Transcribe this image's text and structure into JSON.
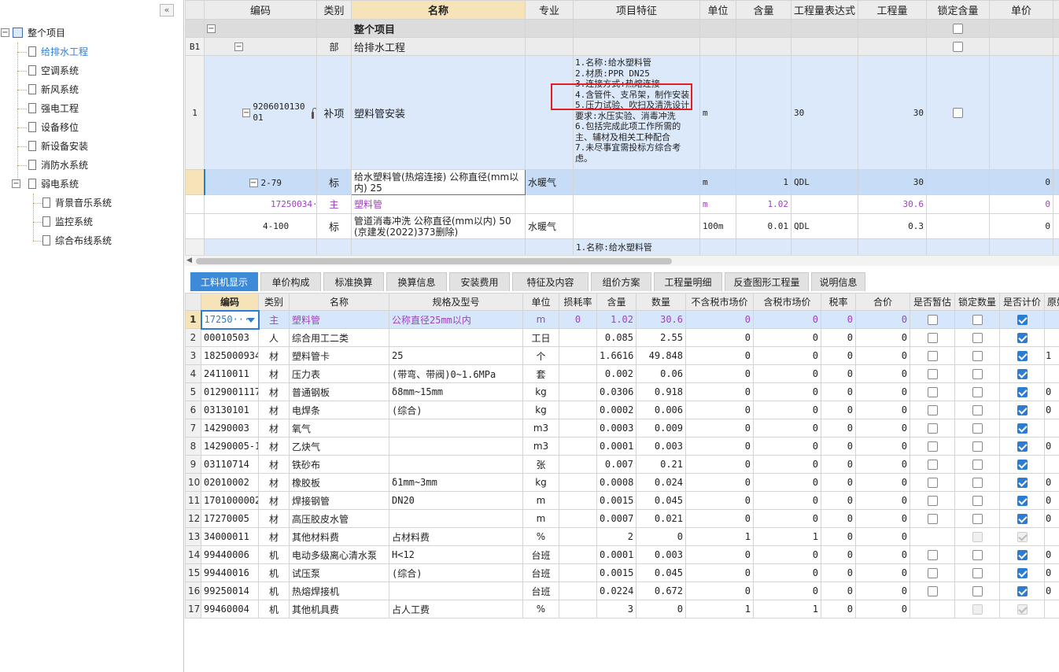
{
  "sidebar": {
    "collapse_label": "«",
    "root": "整个项目",
    "items": [
      {
        "label": "给排水工程",
        "selected": true
      },
      {
        "label": "空调系统"
      },
      {
        "label": "新风系统"
      },
      {
        "label": "强电工程"
      },
      {
        "label": "设备移位"
      },
      {
        "label": "新设备安装"
      },
      {
        "label": "消防水系统"
      }
    ],
    "group": {
      "label": "弱电系统",
      "children": [
        "背景音乐系统",
        "监控系统",
        "综合布线系统"
      ]
    }
  },
  "top_table": {
    "headers": [
      "",
      "编码",
      "类别",
      "名称",
      "专业",
      "项目特征",
      "单位",
      "含量",
      "工程量表达式",
      "工程量",
      "锁定含量",
      "单价"
    ],
    "rows": {
      "project": {
        "name": "整个项目"
      },
      "b1": {
        "index": "B1",
        "category": "部",
        "name": "给排水工程"
      },
      "r1": {
        "index": "1",
        "code_line1": "9206010130",
        "code_line2": "01",
        "lock_icon": "lock-icon",
        "category": "补项",
        "name": "塑料管安装",
        "features": [
          "1.名称:给水塑料管",
          "2.材质:PPR DN25",
          "3.连接方式:热熔连接",
          "4.含管件、支吊架，制作安装",
          "5.压力试验、吹扫及清洗设计要求:水压实验、消毒冲洗",
          "6.包括完成此项工作所需的主、辅材及相关工种配合",
          "7.未尽事宜需投标方综合考虑。"
        ],
        "unit": "m",
        "expr": "30",
        "qty": "30"
      },
      "r279": {
        "code": "2-79",
        "category": "标",
        "name": "给水塑料管(热熔连接) 公称直径(mm以内) 25",
        "major": "水暖气",
        "unit": "m",
        "content": "1",
        "expr": "QDL",
        "qty": "30",
        "price": "0"
      },
      "r1725": {
        "code": "17250034···",
        "category": "主",
        "name": "塑料管",
        "unit": "m",
        "content": "1.02",
        "qty": "30.6",
        "price": "0"
      },
      "r4100": {
        "code": "4-100",
        "category": "标",
        "name": "管道消毒冲洗 公称直径(mm以内) 50 (京建发(2022)373删除)",
        "major": "水暖气",
        "unit": "100m",
        "content": "0.01",
        "expr": "QDL",
        "qty": "0.3",
        "price": "0"
      },
      "partial": {
        "feature": "1.名称:给水塑料管"
      }
    }
  },
  "tabs": [
    "工料机显示",
    "单价构成",
    "标准换算",
    "换算信息",
    "安装费用",
    "特征及内容",
    "组价方案",
    "工程量明细",
    "反查图形工程量",
    "说明信息"
  ],
  "bottom_table": {
    "headers": [
      "",
      "编码",
      "类别",
      "名称",
      "规格及型号",
      "单位",
      "损耗率",
      "含量",
      "数量",
      "不含税市场价",
      "含税市场价",
      "税率",
      "合价",
      "是否暂估",
      "锁定数量",
      "是否计价",
      "原始"
    ],
    "rows": [
      [
        "1",
        "17250···",
        "主",
        "塑料管",
        "公称直径25mm以内",
        "m",
        "0",
        "1.02",
        "30.6",
        "0",
        "0",
        "0",
        "0"
      ],
      [
        "2",
        "00010503",
        "人",
        "综合用工二类",
        "",
        "工日",
        "",
        "0.085",
        "2.55",
        "0",
        "0",
        "0",
        "0"
      ],
      [
        "3",
        "1825000934",
        "材",
        "塑料管卡",
        "25",
        "个",
        "",
        "1.6616",
        "49.848",
        "0",
        "0",
        "0",
        "0"
      ],
      [
        "4",
        "24110011",
        "材",
        "压力表",
        "(带弯、带阀)0~1.6MPa",
        "套",
        "",
        "0.002",
        "0.06",
        "0",
        "0",
        "0",
        "0"
      ],
      [
        "5",
        "0129001117",
        "材",
        "普通钢板",
        "δ8mm~15mm",
        "kg",
        "",
        "0.0306",
        "0.918",
        "0",
        "0",
        "0",
        "0"
      ],
      [
        "6",
        "03130101",
        "材",
        "电焊条",
        "(综合)",
        "kg",
        "",
        "0.0002",
        "0.006",
        "0",
        "0",
        "0",
        "0"
      ],
      [
        "7",
        "14290003",
        "材",
        "氧气",
        "",
        "m3",
        "",
        "0.0003",
        "0.009",
        "0",
        "0",
        "0",
        "0"
      ],
      [
        "8",
        "14290005-1",
        "材",
        "乙炔气",
        "",
        "m3",
        "",
        "0.0001",
        "0.003",
        "0",
        "0",
        "0",
        "0"
      ],
      [
        "9",
        "03110714",
        "材",
        "铁砂布",
        "",
        "张",
        "",
        "0.007",
        "0.21",
        "0",
        "0",
        "0",
        "0"
      ],
      [
        "10",
        "02010002",
        "材",
        "橡胶板",
        "δ1mm~3mm",
        "kg",
        "",
        "0.0008",
        "0.024",
        "0",
        "0",
        "0",
        "0"
      ],
      [
        "11",
        "1701000002",
        "材",
        "焊接钢管",
        "DN20",
        "m",
        "",
        "0.0015",
        "0.045",
        "0",
        "0",
        "0",
        "0"
      ],
      [
        "12",
        "17270005",
        "材",
        "高压胶皮水管",
        "",
        "m",
        "",
        "0.0007",
        "0.021",
        "0",
        "0",
        "0",
        "0"
      ],
      [
        "13",
        "34000011",
        "材",
        "其他材料费",
        "占材料费",
        "%",
        "",
        "2",
        "0",
        "1",
        "1",
        "0",
        "0"
      ],
      [
        "14",
        "99440006",
        "机",
        "电动多级离心清水泵",
        "H<12",
        "台班",
        "",
        "0.0001",
        "0.003",
        "0",
        "0",
        "0",
        "0"
      ],
      [
        "15",
        "99440016",
        "机",
        "试压泵",
        "(综合)",
        "台班",
        "",
        "0.0015",
        "0.045",
        "0",
        "0",
        "0",
        "0"
      ],
      [
        "16",
        "99250014",
        "机",
        "热熔焊接机",
        "",
        "台班",
        "",
        "0.0224",
        "0.672",
        "0",
        "0",
        "0",
        "0"
      ],
      [
        "17",
        "99460004",
        "机",
        "其他机具费",
        "占人工费",
        "%",
        "",
        "3",
        "0",
        "1",
        "1",
        "0",
        "0"
      ]
    ],
    "extra_col": [
      "",
      "",
      "1",
      "",
      "0",
      "0",
      "",
      "0",
      "",
      "0",
      "0",
      "0",
      "",
      "0",
      "0",
      "0",
      ""
    ]
  }
}
